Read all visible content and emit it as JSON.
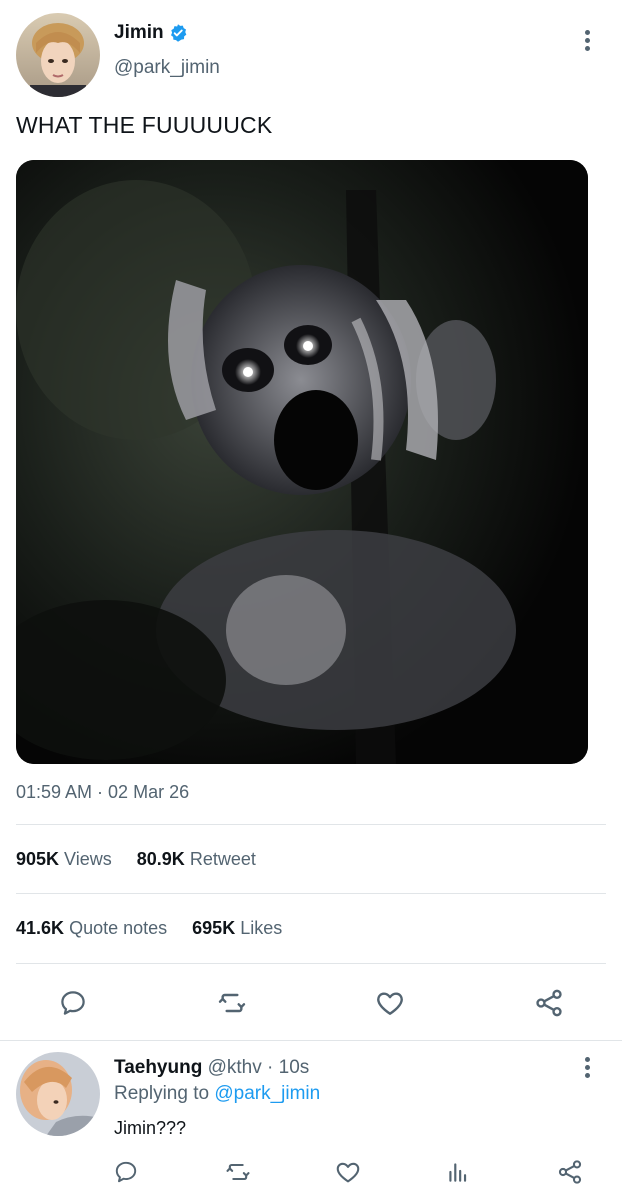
{
  "tweet": {
    "author_name": "Jimin",
    "author_handle": "@park_jimin",
    "verified": true,
    "text": "WHAT THE FUUUUUCK",
    "timestamp": "01:59 AM · 02 Mar 26",
    "stats": {
      "views_count": "905K",
      "views_label": "Views",
      "retweets_count": "80.9K",
      "retweets_label": "Retweet",
      "quotes_count": "41.6K",
      "quotes_label": "Quote notes",
      "likes_count": "695K",
      "likes_label": "Likes"
    }
  },
  "reply": {
    "author_name": "Taehyung",
    "author_handle": "@kthv",
    "time": "· 10s",
    "replying_prefix": "Replying to",
    "replying_handle": "@park_jimin",
    "text": "Jimin???"
  },
  "icons": {
    "reply": "speech-bubble-icon",
    "retweet": "retweet-icon",
    "like": "heart-icon",
    "share": "share-icon",
    "analytics": "bar-chart-icon",
    "verified": "verified-badge-icon",
    "more": "more-vertical-icon"
  },
  "colors": {
    "accent": "#1d9bf0",
    "muted_text": "#536471",
    "primary_text": "#0f1419",
    "divider": "#e1e5e8"
  }
}
